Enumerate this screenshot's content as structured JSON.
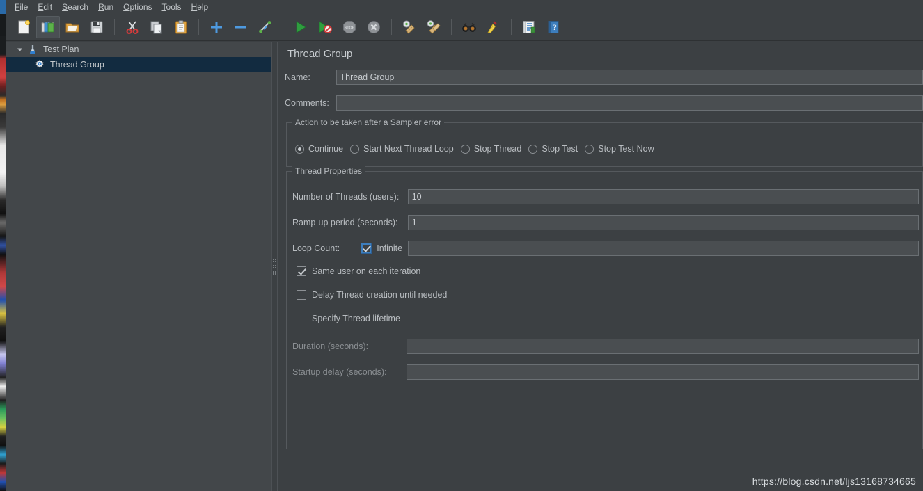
{
  "menubar": {
    "items": [
      {
        "label": "File",
        "mnemonic": "F"
      },
      {
        "label": "Edit",
        "mnemonic": "E"
      },
      {
        "label": "Search",
        "mnemonic": "S"
      },
      {
        "label": "Run",
        "mnemonic": "R"
      },
      {
        "label": "Options",
        "mnemonic": "O"
      },
      {
        "label": "Tools",
        "mnemonic": "T"
      },
      {
        "label": "Help",
        "mnemonic": "H"
      }
    ]
  },
  "toolbar": {
    "buttons": [
      {
        "name": "new-icon",
        "title": "New"
      },
      {
        "name": "templates-icon",
        "title": "Templates"
      },
      {
        "name": "open-icon",
        "title": "Open"
      },
      {
        "name": "save-icon",
        "title": "Save"
      },
      {
        "name": "cut-icon",
        "title": "Cut"
      },
      {
        "name": "copy-icon",
        "title": "Copy"
      },
      {
        "name": "paste-icon",
        "title": "Paste"
      },
      {
        "name": "expand-all-icon",
        "title": "Expand all"
      },
      {
        "name": "collapse-all-icon",
        "title": "Collapse all"
      },
      {
        "name": "toggle-icon",
        "title": "Toggle"
      },
      {
        "name": "start-icon",
        "title": "Start"
      },
      {
        "name": "start-no-pauses-icon",
        "title": "Start no pauses"
      },
      {
        "name": "stop-icon",
        "title": "Stop"
      },
      {
        "name": "shutdown-icon",
        "title": "Shutdown"
      },
      {
        "name": "clear-icon",
        "title": "Clear"
      },
      {
        "name": "clear-all-icon",
        "title": "Clear All"
      },
      {
        "name": "search-icon",
        "title": "Search"
      },
      {
        "name": "reset-search-icon",
        "title": "Reset Search"
      },
      {
        "name": "function-helper-icon",
        "title": "Function Helper Dialog"
      },
      {
        "name": "help-icon",
        "title": "Help"
      }
    ]
  },
  "tree": {
    "nodes": [
      {
        "label": "Test Plan",
        "icon": "test-plan-icon",
        "selected": false,
        "expanded": true,
        "depth": 0
      },
      {
        "label": "Thread Group",
        "icon": "thread-group-icon",
        "selected": true,
        "expanded": false,
        "depth": 1
      }
    ]
  },
  "panel": {
    "title": "Thread Group",
    "name_label": "Name:",
    "name_value": "Thread Group",
    "comments_label": "Comments:",
    "comments_value": "",
    "error_action": {
      "group_title": "Action to be taken after a Sampler error",
      "options": [
        {
          "label": "Continue",
          "selected": true
        },
        {
          "label": "Start Next Thread Loop",
          "selected": false
        },
        {
          "label": "Stop Thread",
          "selected": false
        },
        {
          "label": "Stop Test",
          "selected": false
        },
        {
          "label": "Stop Test Now",
          "selected": false
        }
      ]
    },
    "thread_properties": {
      "group_title": "Thread Properties",
      "num_threads_label": "Number of Threads (users):",
      "num_threads_value": "10",
      "rampup_label": "Ramp-up period (seconds):",
      "rampup_value": "1",
      "loop_count_label": "Loop Count:",
      "loop_infinite_label": "Infinite",
      "loop_infinite_checked": true,
      "loop_count_value": "",
      "same_user_label": "Same user on each iteration",
      "same_user_checked": true,
      "delay_thread_label": "Delay Thread creation until needed",
      "delay_thread_checked": false,
      "specify_lifetime_label": "Specify Thread lifetime",
      "specify_lifetime_checked": false,
      "duration_label": "Duration (seconds):",
      "duration_value": "",
      "duration_enabled": false,
      "startup_delay_label": "Startup delay (seconds):",
      "startup_delay_value": "",
      "startup_delay_enabled": false
    }
  },
  "watermark": {
    "text": "https://blog.csdn.net/ljs13168734665"
  },
  "colors": {
    "window_bg": "#3c4043",
    "tree_bg": "#43474a",
    "selection": "#122b40",
    "field_bg": "#4a4e51",
    "text": "#b9bdc1",
    "accent_blue": "#3d7ebd"
  }
}
